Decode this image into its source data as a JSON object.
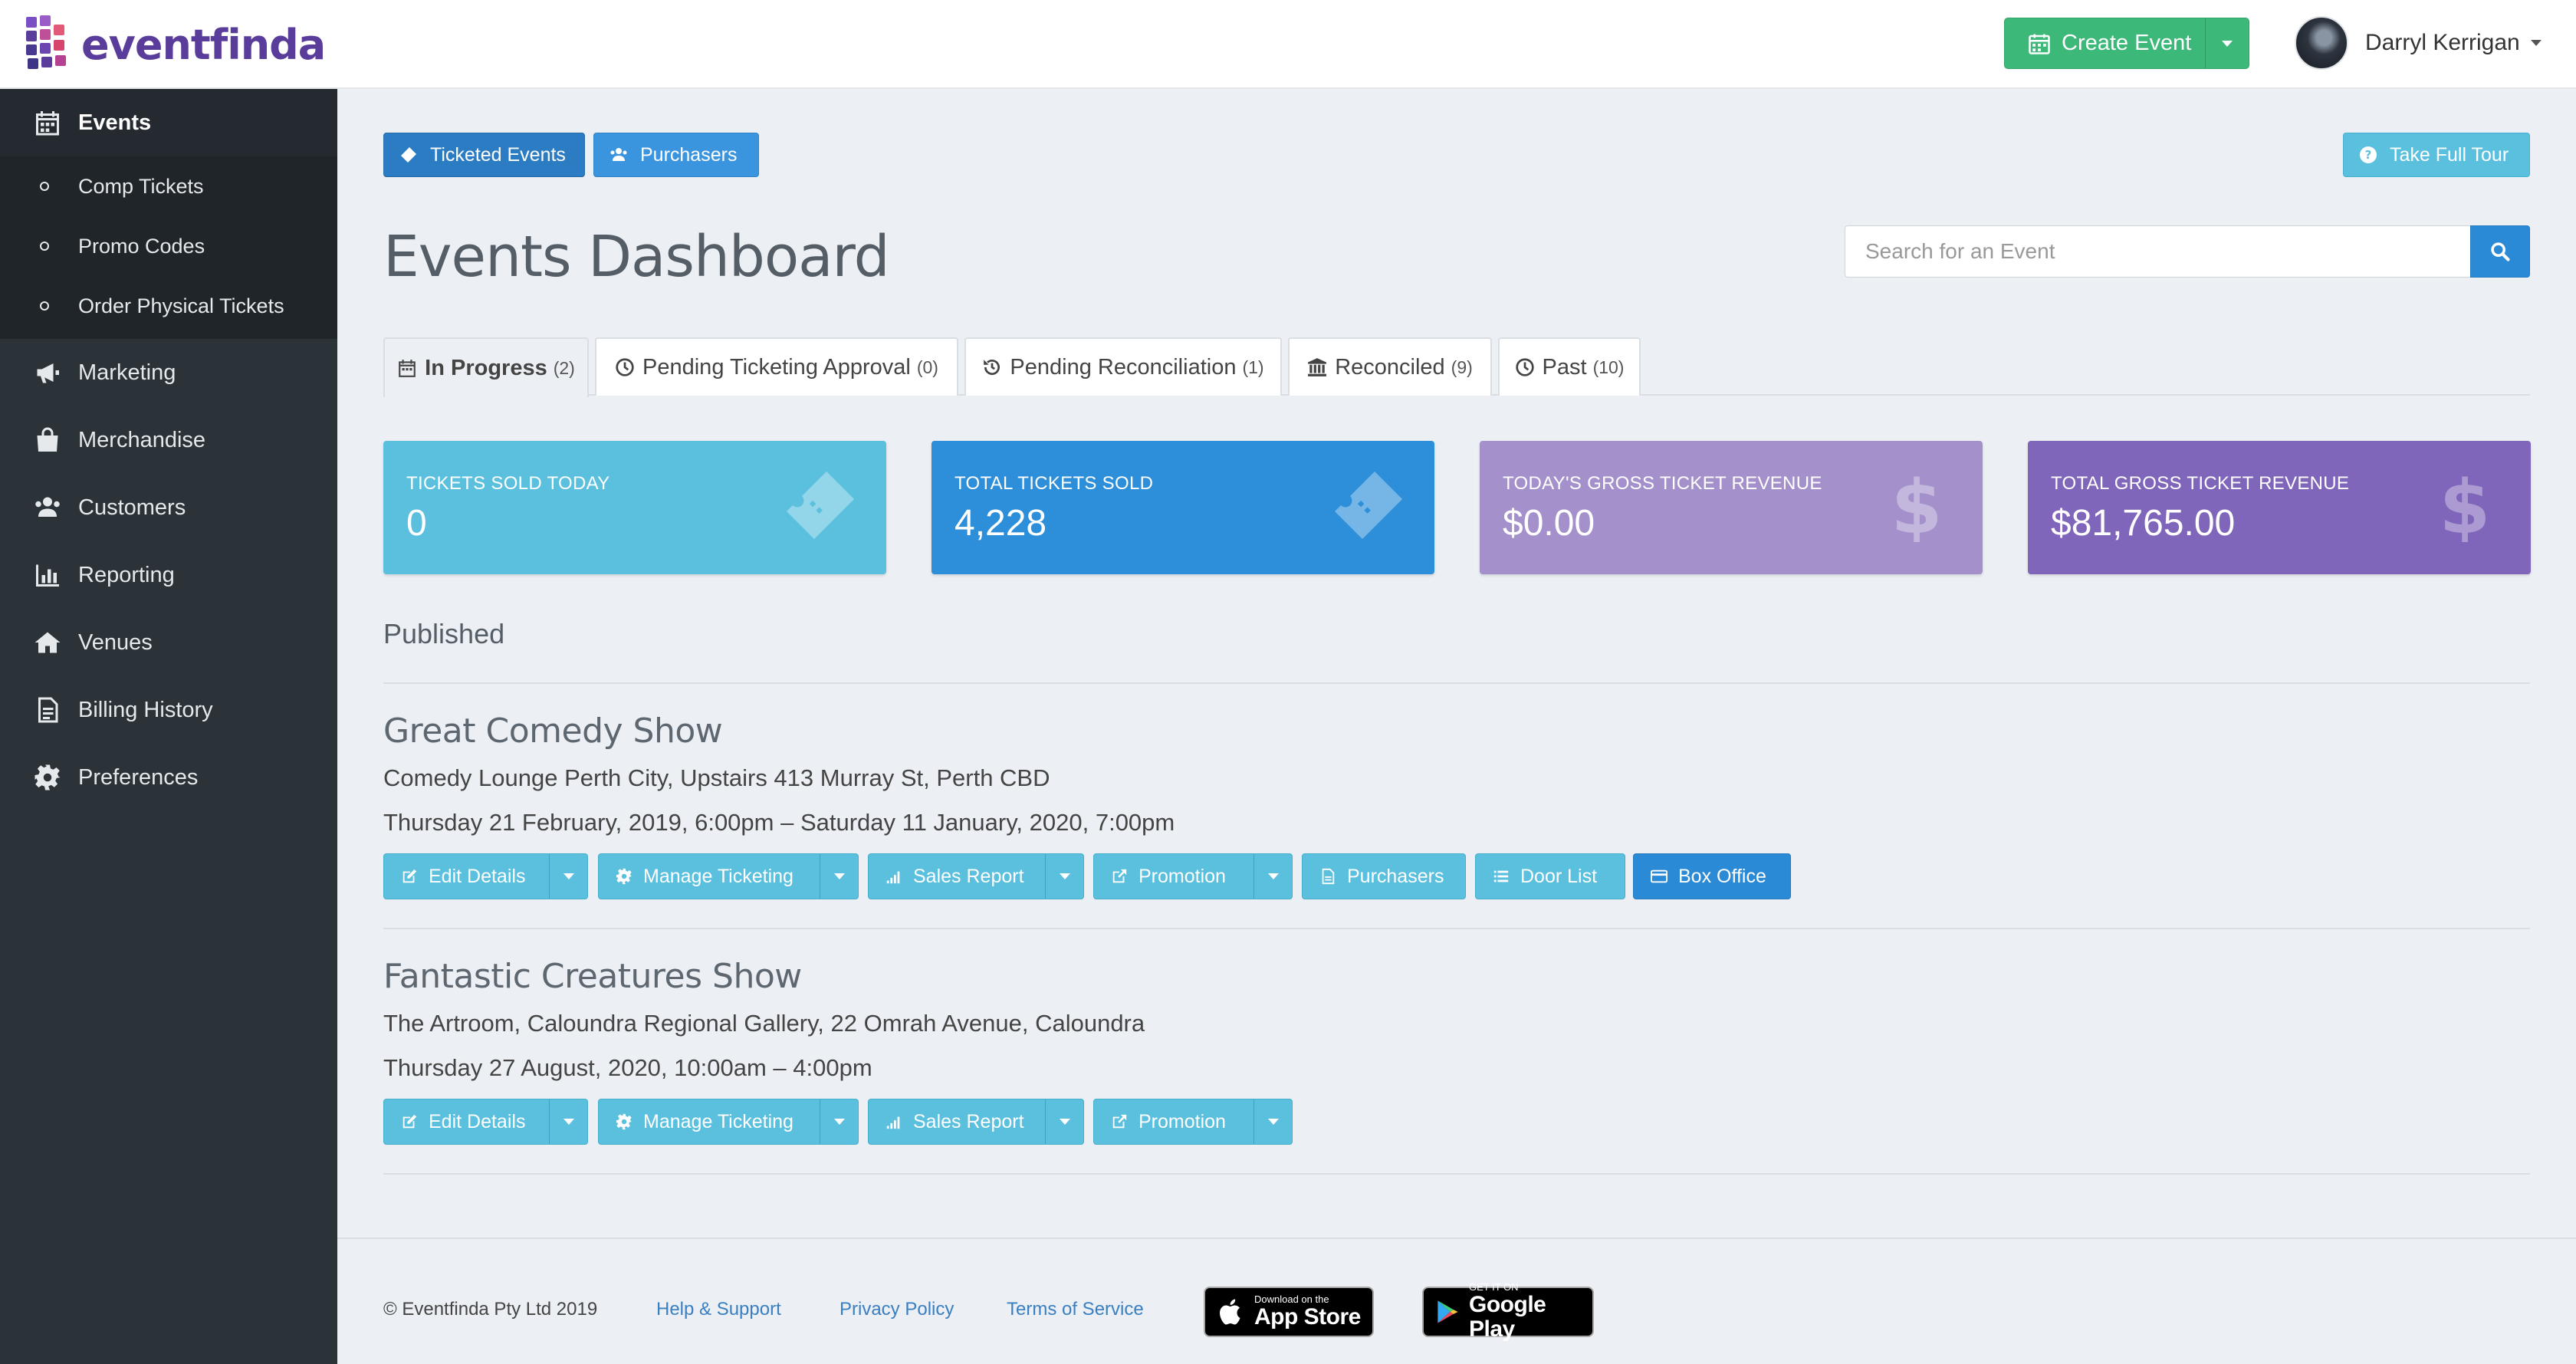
{
  "header": {
    "logo_text": "eventfinda",
    "create_event_label": "Create Event",
    "user_name": "Darryl Kerrigan"
  },
  "sidebar": {
    "items": [
      {
        "label": "Events",
        "icon": "calendar-icon",
        "active": true
      },
      {
        "label": "Marketing",
        "icon": "megaphone-icon"
      },
      {
        "label": "Merchandise",
        "icon": "shopping-bag-icon"
      },
      {
        "label": "Customers",
        "icon": "users-icon"
      },
      {
        "label": "Reporting",
        "icon": "bar-chart-icon"
      },
      {
        "label": "Venues",
        "icon": "home-icon"
      },
      {
        "label": "Billing History",
        "icon": "document-icon"
      },
      {
        "label": "Preferences",
        "icon": "gear-icon"
      }
    ],
    "sub_items": [
      "Comp Tickets",
      "Promo Codes",
      "Order Physical Tickets"
    ]
  },
  "toolbar": {
    "ticketed_events": "Ticketed Events",
    "purchasers": "Purchasers",
    "take_tour": "Take Full Tour"
  },
  "page_title": "Events Dashboard",
  "search": {
    "placeholder": "Search for an Event"
  },
  "tabs": [
    {
      "label": "In Progress",
      "count": "(2)",
      "icon": "calendar-icon",
      "active": true
    },
    {
      "label": "Pending Ticketing Approval",
      "count": "(0)",
      "icon": "clock-icon"
    },
    {
      "label": "Pending Reconciliation",
      "count": "(1)",
      "icon": "history-icon"
    },
    {
      "label": "Reconciled",
      "count": "(9)",
      "icon": "bank-icon"
    },
    {
      "label": "Past",
      "count": "(10)",
      "icon": "clock-icon"
    }
  ],
  "stats": [
    {
      "label": "Tickets Sold Today",
      "value": "0",
      "icon": "ticket-icon",
      "color": "#5bc0de"
    },
    {
      "label": "Total Tickets Sold",
      "value": "4,228",
      "icon": "ticket-icon",
      "color": "#2d8fd9"
    },
    {
      "label": "Today's Gross Ticket Revenue",
      "value": "$0.00",
      "icon": "dollar-icon",
      "color": "#a491cc"
    },
    {
      "label": "Total Gross Ticket Revenue",
      "value": "$81,765.00",
      "icon": "dollar-icon",
      "color": "#7f66ba"
    }
  ],
  "section_title": "Published",
  "events": [
    {
      "title": "Great Comedy Show",
      "venue": "Comedy Lounge Perth City, Upstairs 413 Murray St, Perth CBD",
      "date": "Thursday 21 February, 2019, 6:00pm – Saturday 11 January, 2020, 7:00pm",
      "buttons": {
        "edit": "Edit Details",
        "ticketing": "Manage Ticketing",
        "sales": "Sales Report",
        "promotion": "Promotion",
        "purchasers": "Purchasers",
        "door_list": "Door List",
        "box_office": "Box Office"
      }
    },
    {
      "title": "Fantastic Creatures Show",
      "venue": "The Artroom, Caloundra Regional Gallery, 22 Omrah Avenue, Caloundra",
      "date": "Thursday 27 August, 2020, 10:00am – 4:00pm",
      "buttons": {
        "edit": "Edit Details",
        "ticketing": "Manage Ticketing",
        "sales": "Sales Report",
        "promotion": "Promotion"
      }
    }
  ],
  "footer": {
    "copyright": "© Eventfinda Pty Ltd 2019",
    "help": "Help & Support",
    "privacy": "Privacy Policy",
    "terms": "Terms of Service",
    "app_store_small": "Download on the",
    "app_store_big": "App Store",
    "google_small": "GET IT ON",
    "google_big": "Google Play"
  }
}
